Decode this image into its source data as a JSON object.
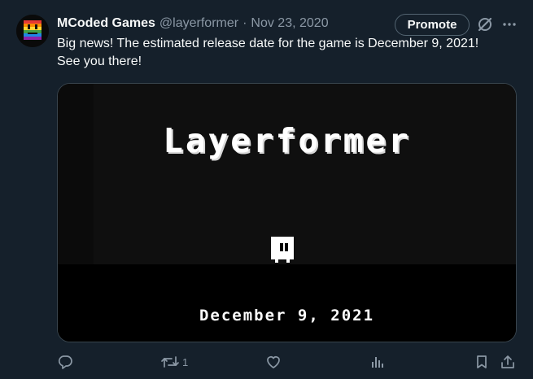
{
  "tweet": {
    "display_name": "MCoded Games",
    "handle": "@layerformer",
    "separator": "·",
    "date": "Nov 23, 2020",
    "promote_label": "Promote",
    "text_lines": [
      "Big news! The estimated release date for the game is December 9, 2021!",
      "See you there!"
    ]
  },
  "media": {
    "game_title": "Layerformer",
    "release_date": "December 9, 2021"
  },
  "actions": {
    "retweet_count": "1"
  },
  "icons": {
    "reply": "reply-icon",
    "retweet": "retweet-icon",
    "like": "heart-icon",
    "views": "analytics-icon",
    "bookmark": "bookmark-icon",
    "share": "share-icon",
    "grok": "grok-icon",
    "more": "more-icon"
  },
  "colors": {
    "background": "#15202b",
    "text": "#f7f9f9",
    "secondary": "#8b98a5",
    "border": "#38444d"
  }
}
